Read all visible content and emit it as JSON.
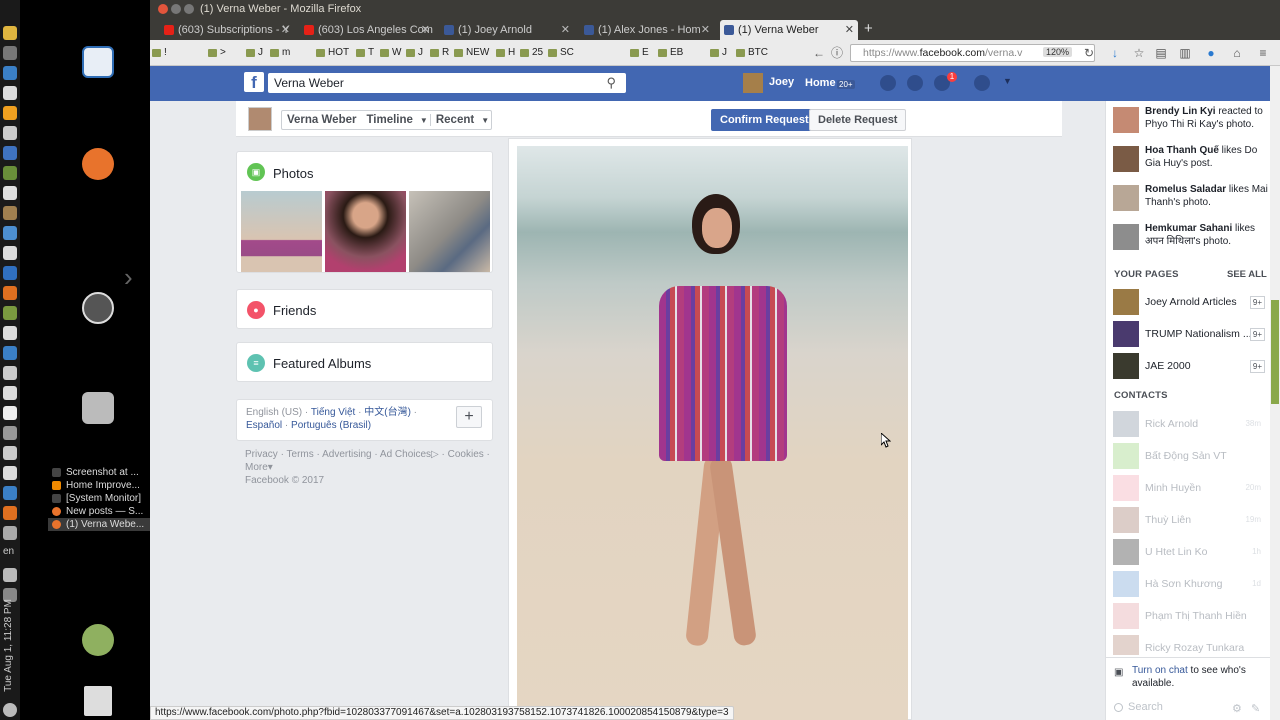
{
  "window": {
    "title": "(1) Verna Weber - Mozilla Firefox"
  },
  "tabs": [
    {
      "label": "(603) Subscriptions - Y"
    },
    {
      "label": "(603) Los Angeles Com"
    },
    {
      "label": "(1) Joey Arnold"
    },
    {
      "label": "(1) Alex Jones - Hom"
    },
    {
      "label": "(1) Verna Weber"
    }
  ],
  "bookmarks": [
    "!",
    ">",
    "J",
    "m",
    "HOT",
    "T",
    "W",
    "J",
    "R",
    "NEW",
    "H",
    "25",
    "SC",
    "E",
    "EB",
    "J",
    "BTC"
  ],
  "url": {
    "prefix": "https://www.",
    "domain": "facebook.com",
    "rest": "/verna.v",
    "zoom": "120%"
  },
  "desktop": {
    "tasks": [
      "Screenshot at ...",
      "Home Improve...",
      "[System Monitor]",
      "New posts — S...",
      "(1) Verna Webe..."
    ],
    "lang": "en",
    "clock": "Tue Aug 1, 11:28 PM"
  },
  "fb": {
    "search_value": "Verna Weber",
    "user": "Joey",
    "home_label": "Home",
    "home_count": "20+",
    "notif_count": "1",
    "profile": {
      "name": "Verna Weber",
      "timeline": "Timeline",
      "recent": "Recent",
      "confirm": "Confirm Request",
      "delete": "Delete Request"
    },
    "cards": {
      "photos": "Photos",
      "friends": "Friends",
      "albums": "Featured Albums"
    },
    "languages": {
      "current": "English (US)",
      "links": [
        "Tiếng Việt",
        "中文(台灣)",
        "Español",
        "Português (Brasil)"
      ]
    },
    "footer": {
      "links": [
        "Privacy",
        "Terms",
        "Advertising",
        "Ad Choices",
        "Cookies",
        "More"
      ],
      "copyright": "Facebook © 2017"
    },
    "ticker": [
      {
        "actor": "Brendy Lin Kyi",
        "text": " reacted to Phyo Thi Ri Kay's photo."
      },
      {
        "actor": "Hoa Thanh Quế",
        "text": " likes Do Gia Huy's post."
      },
      {
        "actor": "Romelus Saladar",
        "text": " likes Mai Thanh's photo."
      },
      {
        "actor": "Hemkumar Sahani",
        "text": " likes अपन मिथिला's photo."
      }
    ],
    "your_pages": {
      "heading": "YOUR PAGES",
      "see_all": "SEE ALL",
      "items": [
        {
          "name": "Joey Arnold Articles",
          "count": "9+"
        },
        {
          "name": "TRUMP Nationalism ...",
          "count": "9+"
        },
        {
          "name": "JAE 2000",
          "count": "9+"
        }
      ]
    },
    "contacts": {
      "heading": "CONTACTS",
      "items": [
        {
          "name": "Rick Arnold",
          "ago": "38m"
        },
        {
          "name": "Bất Động Sản VT",
          "ago": ""
        },
        {
          "name": "Minh Huyền",
          "ago": "20m"
        },
        {
          "name": "Thuỳ Liên",
          "ago": "19m"
        },
        {
          "name": "U Htet Lin Ko",
          "ago": "1h"
        },
        {
          "name": "Hà Sơn Khương",
          "ago": "1d"
        },
        {
          "name": "Phạm Thị Thanh Hiền",
          "ago": ""
        },
        {
          "name": "Ricky Rozay Tunkara",
          "ago": ""
        }
      ]
    },
    "chat": {
      "link": "Turn on chat",
      "rest": " to see who's available.",
      "search_placeholder": "Search"
    }
  },
  "status_url": "https://www.facebook.com/photo.php?fbid=102803377091467&set=a.102803193758152.1073741826.100020854150879&type=3"
}
